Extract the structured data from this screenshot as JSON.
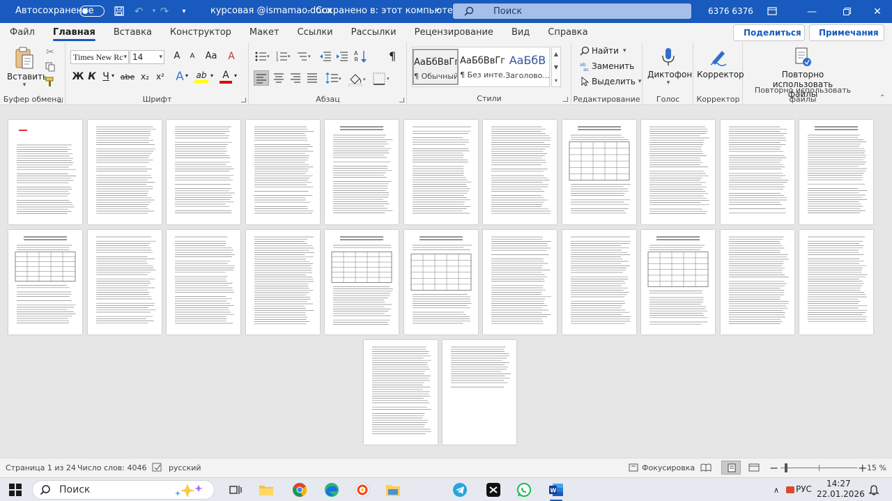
{
  "titlebar": {
    "autosave_label": "Автосохранение",
    "doc_title": "курсовая @ismamao.docx",
    "save_status": "Сохранено в: этот компьютер",
    "search_placeholder": "Поиск",
    "user": "6376 6376"
  },
  "menu": {
    "tabs": [
      "Файл",
      "Главная",
      "Вставка",
      "Конструктор",
      "Макет",
      "Ссылки",
      "Рассылки",
      "Рецензирование",
      "Вид",
      "Справка"
    ],
    "active_tab": "Главная",
    "share_label": "Поделиться",
    "comments_label": "Примечания"
  },
  "ribbon": {
    "clipboard": {
      "paste_label": "Вставить",
      "group_label": "Буфер обмена"
    },
    "font": {
      "font_name": "Times New Rc",
      "font_size": "14",
      "group_label": "Шрифт",
      "bold": "Ж",
      "italic": "К",
      "underline": "Ч",
      "strike": "abe",
      "sub": "x₂",
      "sup": "x²",
      "grow": "A",
      "shrink": "A",
      "case": "Aa",
      "clear": "A",
      "effects": "A",
      "highlight": "ab",
      "color": "A"
    },
    "paragraph": {
      "group_label": "Абзац",
      "pilcrow": "¶"
    },
    "styles": {
      "group_label": "Стили",
      "items": [
        {
          "sample": "АаБбВвГг,",
          "name": "¶ Обычный"
        },
        {
          "sample": "АаБбВвГг,",
          "name": "¶ Без инте..."
        },
        {
          "sample": "АаБбВ",
          "name": "Заголово..."
        }
      ],
      "accent_color": "#2f5496"
    },
    "editing": {
      "group_label": "Редактирование",
      "find": "Найти",
      "replace": "Заменить",
      "select": "Выделить"
    },
    "voice": {
      "group_label": "Голос",
      "dictate": "Диктофон"
    },
    "editor": {
      "group_label": "Корректор",
      "label": "Корректор"
    },
    "reuse": {
      "group_label": "Повторно использовать файлы",
      "line1": "Повторно",
      "line2": "использовать файлы"
    }
  },
  "status": {
    "page": "Страница 1 из 24",
    "words": "Число слов: 4046",
    "language": "русский",
    "focus": "Фокусировка",
    "zoom": "15 %"
  },
  "taskbar": {
    "search_placeholder": "Поиск",
    "lang": "РУС",
    "time": "14:27",
    "date": "22.01.2026"
  },
  "colors": {
    "word_blue": "#185abd",
    "title_search_bg": "#a5c0e8",
    "font_color_bar": "#e00000",
    "highlight_bar": "#ffff00"
  }
}
